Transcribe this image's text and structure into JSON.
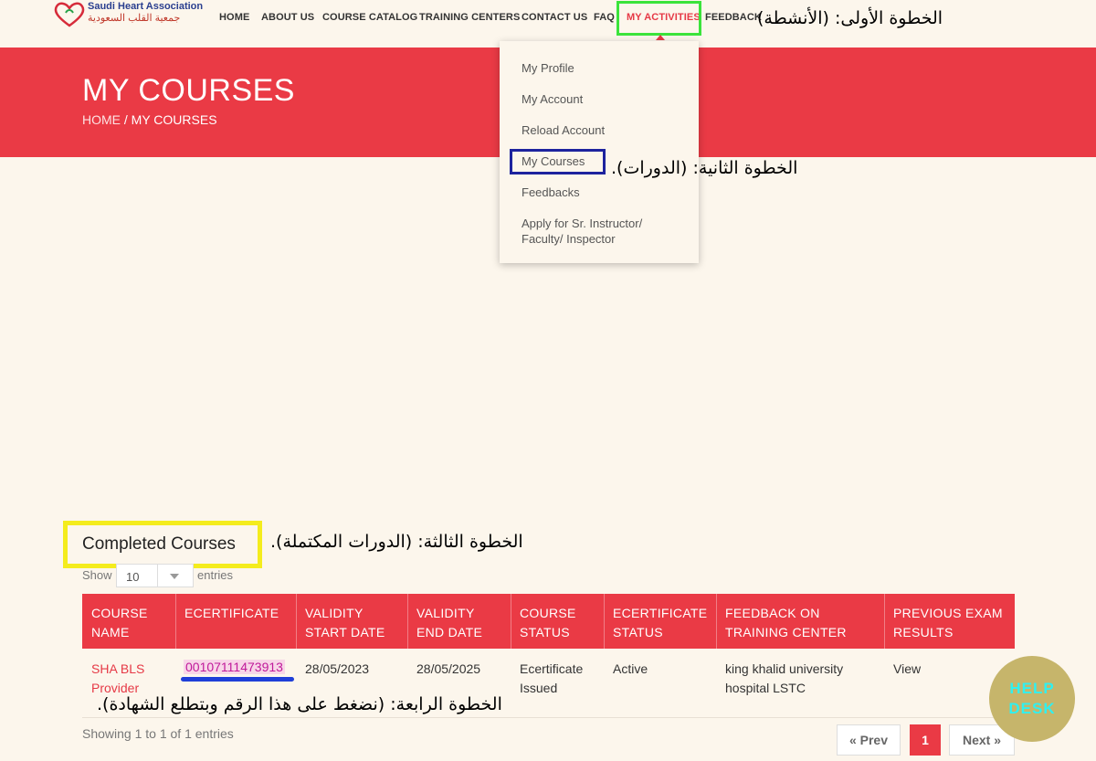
{
  "logo": {
    "en": "Saudi Heart Association",
    "ar": "جمعية القلب السعودية"
  },
  "nav": {
    "home": "HOME",
    "about": "ABOUT US",
    "catalog": "COURSE CATALOG",
    "centers": "TRAINING CENTERS",
    "contact": "CONTACT US",
    "faq": "FAQ",
    "activities": "MY ACTIVITIES",
    "feedback": "FEEDBACK"
  },
  "annotations": {
    "step1": "الخطوة الأولى: (الأنشطة)",
    "step2": "الخطوة الثانية: (الدورات).",
    "step3": "الخطوة الثالثة: (الدورات المكتملة).",
    "step4": "الخطوة الرابعة: (نضغط على هذا الرقم وبتطلع الشهادة)."
  },
  "banner": {
    "title": "MY COURSES",
    "crumb_home": "HOME",
    "crumb_sep": "/",
    "crumb_current": "MY COURSES"
  },
  "dropdown": {
    "items": [
      "My Profile",
      "My Account",
      "Reload Account",
      "My Courses",
      "Feedbacks",
      "Apply for Sr. Instructor/",
      "Faculty/ Inspector"
    ]
  },
  "completed": {
    "title": "Completed Courses",
    "show": "Show",
    "entries_value": "10",
    "entries": "entries"
  },
  "table": {
    "headers": [
      [
        "COURSE",
        "NAME"
      ],
      [
        "ECERTIFICATE",
        ""
      ],
      [
        "VALIDITY",
        "START DATE"
      ],
      [
        "VALIDITY",
        "END DATE"
      ],
      [
        "COURSE",
        "STATUS"
      ],
      [
        "ECERTIFICATE",
        "STATUS"
      ],
      [
        "FEEDBACK ON",
        "TRAINING CENTER"
      ],
      [
        "PREVIOUS EXAM",
        "RESULTS"
      ]
    ],
    "row": {
      "course_name": [
        "SHA BLS",
        "Provider"
      ],
      "ecertificate": "00107111473913",
      "start": "28/05/2023",
      "end": "28/05/2025",
      "course_status": [
        "Ecertificate",
        "Issued"
      ],
      "cert_status": "Active",
      "feedback": [
        "king khalid university",
        "hospital LSTC"
      ],
      "results": "View"
    }
  },
  "footer": {
    "showing": "Showing 1 to 1 of 1 entries",
    "prev": "« Prev",
    "page": "1",
    "next": "Next »"
  },
  "helpdesk": {
    "line1": "HELP",
    "line2": "DESK"
  }
}
